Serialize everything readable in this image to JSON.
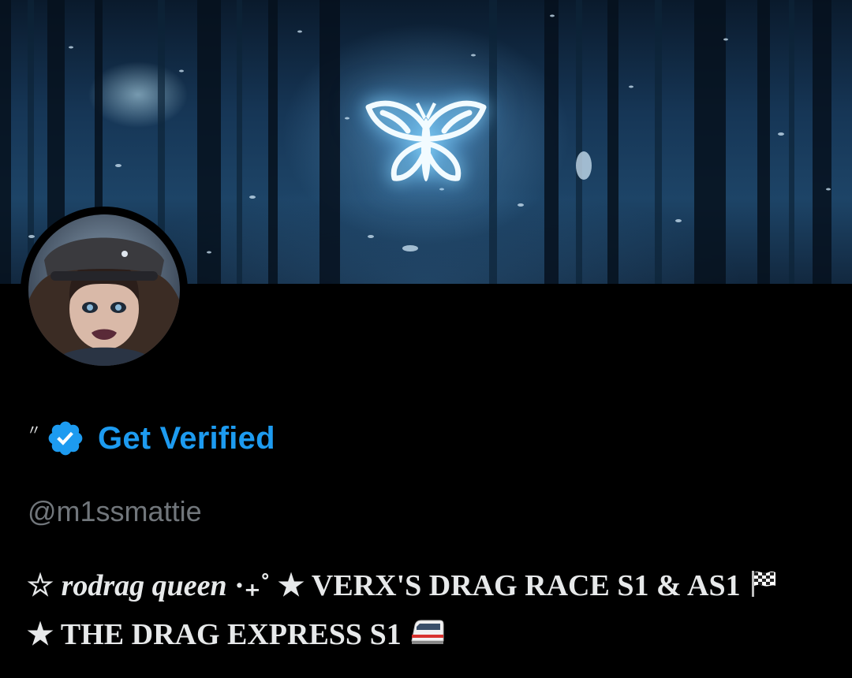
{
  "profile": {
    "display_name": "〃",
    "verify_label": "Get Verified",
    "handle": "@m1ssmattie",
    "bio": {
      "line1_star_outline": "☆",
      "line1_italic": "rodrag queen",
      "line1_sparkle": "·₊˚",
      "line1_rest": "★ VERX'S DRAG RACE S1 & AS1",
      "line2": "★ THE DRAG EXPRESS S1"
    }
  },
  "icons": {
    "verified": "verified-badge-icon",
    "banner": "butterfly-icon",
    "flag": "checkered-flag-icon",
    "train": "train-icon"
  },
  "colors": {
    "background": "#000000",
    "accent": "#1d9bf0",
    "handle": "#71767b",
    "text": "#e7e9ea"
  }
}
